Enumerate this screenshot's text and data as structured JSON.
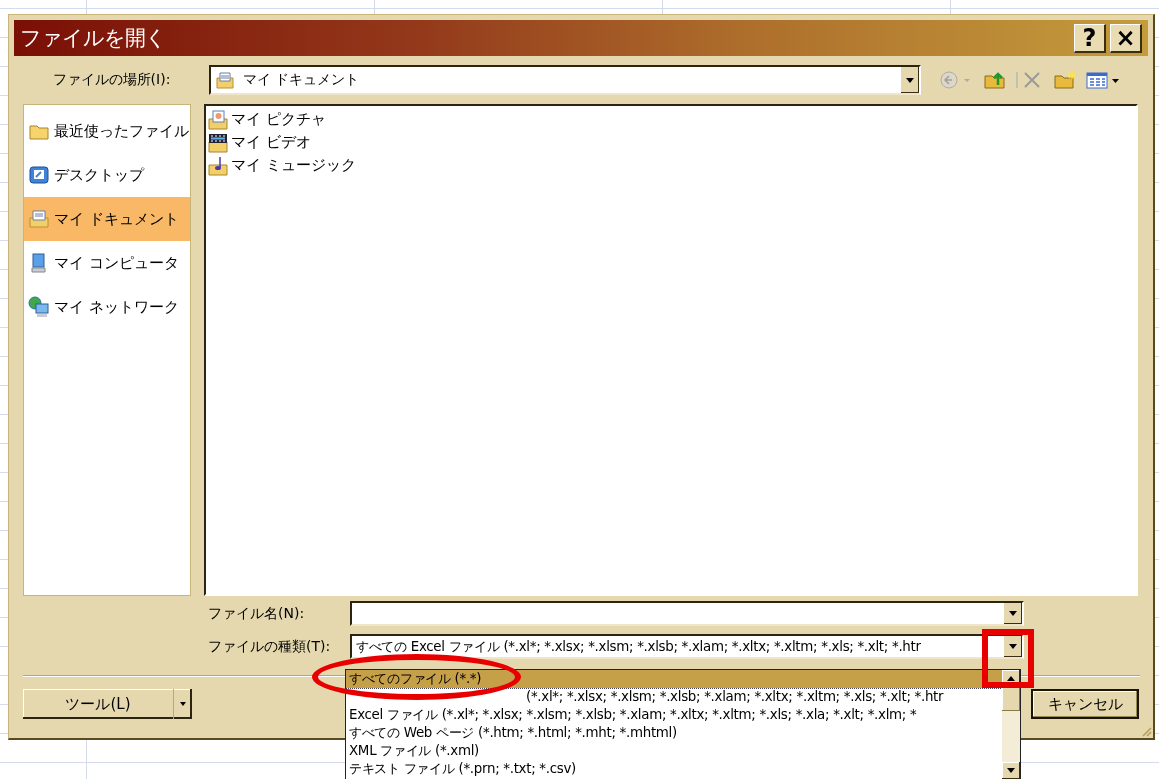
{
  "window": {
    "title": "ファイルを開く",
    "help_button": "?",
    "close_button": "×"
  },
  "location": {
    "label": "ファイルの場所(I):",
    "value": "マイ ドキュメント"
  },
  "toolbar": [
    {
      "kind": "back",
      "disabled": true
    },
    {
      "kind": "up",
      "disabled": false
    },
    {
      "kind": "delete",
      "disabled": true
    },
    {
      "kind": "newfolder",
      "disabled": false
    },
    {
      "kind": "views",
      "disabled": false
    }
  ],
  "places": [
    {
      "label": "最近使ったファイル",
      "kind": "folder",
      "selected": false
    },
    {
      "label": "デスクトップ",
      "kind": "desktop",
      "selected": false
    },
    {
      "label": "マイ ドキュメント",
      "kind": "documents",
      "selected": true
    },
    {
      "label": "マイ コンピュータ",
      "kind": "computer",
      "selected": false
    },
    {
      "label": "マイ ネットワーク",
      "kind": "network",
      "selected": false
    }
  ],
  "files": [
    {
      "name": "マイ ピクチャ",
      "kind": "pictures"
    },
    {
      "name": "マイ ビデオ",
      "kind": "video"
    },
    {
      "name": "マイ ミュージック",
      "kind": "music"
    }
  ],
  "file_name": {
    "label": "ファイル名(N):"
  },
  "file_type": {
    "label": "ファイルの種類(T):",
    "value": "すべての Excel ファイル (*.xl*; *.xlsx; *.xlsm; *.xlsb; *.xlam; *.xltx; *.xltm; *.xls; *.xlt; *.htr",
    "options": [
      {
        "label": "すべてのファイル (*.*)",
        "selected": true
      },
      {
        "label": "(*.xl*; *.xlsx; *.xlsm; *.xlsb; *.xlam; *.xltx; *.xltm; *.xls; *.xlt; *.htr",
        "selected": false,
        "covered": true
      },
      {
        "label": "Excel ファイル (*.xl*; *.xlsx; *.xlsm; *.xlsb; *.xlam; *.xltx; *.xltm; *.xls; *.xla; *.xlt; *.xlm; *",
        "selected": false
      },
      {
        "label": "すべての Web ページ (*.htm; *.html; *.mht; *.mhtml)",
        "selected": false
      },
      {
        "label": "XML ファイル (*.xml)",
        "selected": false
      },
      {
        "label": "テキスト ファイル (*.prn; *.txt; *.csv)",
        "selected": false
      }
    ]
  },
  "tools_button": "ツール(L)",
  "cancel_button": "キャンセル",
  "annotations": {
    "ellipse": {
      "color": "#e80000"
    },
    "rectangle": {
      "color": "#e80000"
    }
  }
}
